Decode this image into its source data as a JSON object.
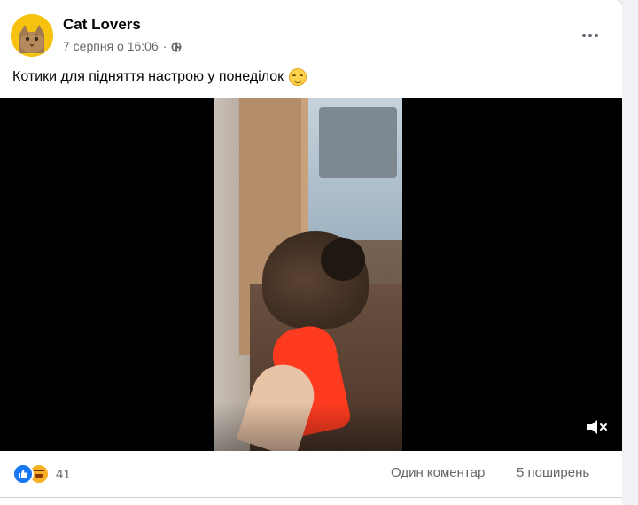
{
  "post": {
    "page_name": "Cat Lovers",
    "date": "7 серпня о 16:06",
    "separator": "·",
    "privacy_icon": "globe-icon",
    "more_icon": "more-options-icon",
    "text": "Котики для підняття настрою у понеділок",
    "text_emoji": "smiling-face-emoji"
  },
  "video": {
    "volume_icon": "volume-muted-icon"
  },
  "footer": {
    "reaction_icons": [
      "like-reaction-icon",
      "haha-reaction-icon"
    ],
    "reaction_count": "41",
    "comments": "Один коментар",
    "shares": "5 поширень"
  },
  "colors": {
    "like": "#1877f2",
    "haha": "#f7b125",
    "avatar_bg": "#f6c20f",
    "slipper": "#ff3b1f",
    "secondary_text": "#65676b"
  }
}
